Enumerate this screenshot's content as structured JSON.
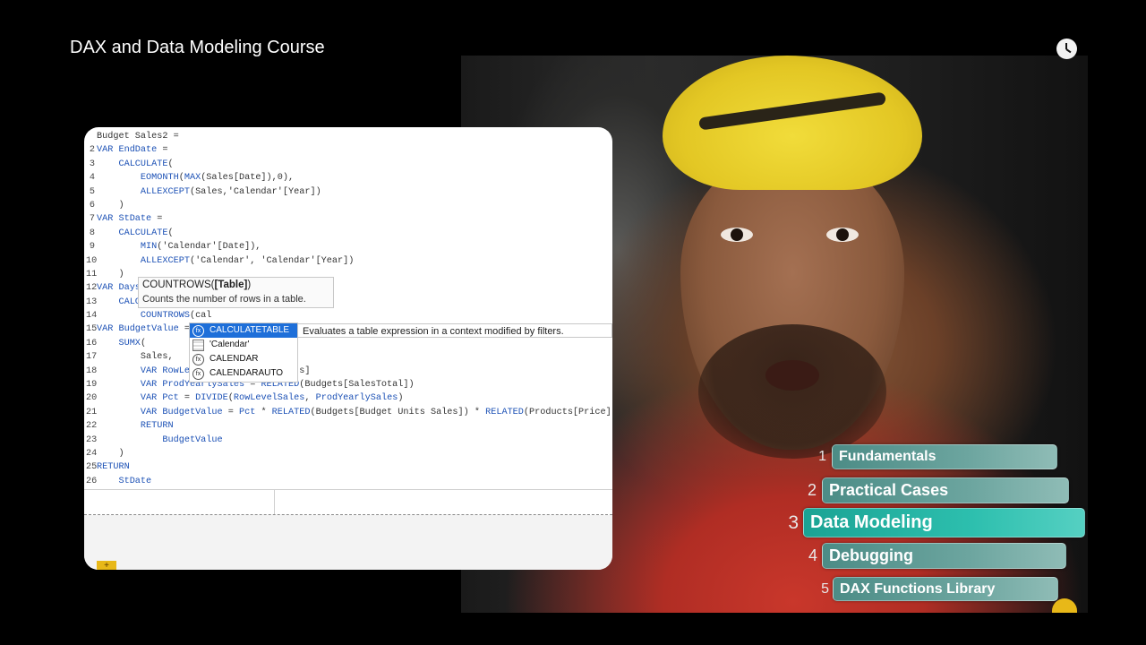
{
  "header": {
    "title": "DAX and Data Modeling Course",
    "clock_icon": "clock-icon"
  },
  "editor": {
    "lines": [
      {
        "n": "",
        "parts": [
          [
            "t",
            "Budget Sales2 ="
          ]
        ]
      },
      {
        "n": "2",
        "parts": [
          [
            "k",
            "VAR "
          ],
          [
            "k",
            "EndDate"
          ],
          [
            "t",
            " ="
          ]
        ]
      },
      {
        "n": "3",
        "parts": [
          [
            "t",
            "    "
          ],
          [
            "k",
            "CALCULATE"
          ],
          [
            "t",
            "("
          ]
        ]
      },
      {
        "n": "4",
        "parts": [
          [
            "t",
            "        "
          ],
          [
            "k",
            "EOMONTH"
          ],
          [
            "t",
            "("
          ],
          [
            "k",
            "MAX"
          ],
          [
            "t",
            "(Sales[Date]),"
          ],
          [
            "t",
            "0"
          ],
          [
            "t",
            "),"
          ]
        ]
      },
      {
        "n": "5",
        "parts": [
          [
            "t",
            "        "
          ],
          [
            "k",
            "ALLEXCEPT"
          ],
          [
            "t",
            "(Sales,'Calendar'[Year])"
          ]
        ]
      },
      {
        "n": "6",
        "parts": [
          [
            "t",
            "    )"
          ]
        ]
      },
      {
        "n": "7",
        "parts": [
          [
            "k",
            "VAR "
          ],
          [
            "k",
            "StDate"
          ],
          [
            "t",
            " ="
          ]
        ]
      },
      {
        "n": "8",
        "parts": [
          [
            "t",
            "    "
          ],
          [
            "k",
            "CALCULATE"
          ],
          [
            "t",
            "("
          ]
        ]
      },
      {
        "n": "9",
        "parts": [
          [
            "t",
            "        "
          ],
          [
            "k",
            "MIN"
          ],
          [
            "t",
            "('Calendar'[Date]),"
          ]
        ]
      },
      {
        "n": "10",
        "parts": [
          [
            "t",
            "        "
          ],
          [
            "k",
            "ALLEXCEPT"
          ],
          [
            "t",
            "('Calendar', 'Calendar'[Year])"
          ]
        ]
      },
      {
        "n": "11",
        "parts": [
          [
            "t",
            "    )"
          ]
        ]
      },
      {
        "n": "12",
        "parts": [
          [
            "k",
            "VAR "
          ],
          [
            "k",
            "Days"
          ]
        ]
      },
      {
        "n": "13",
        "parts": [
          [
            "t",
            "    "
          ],
          [
            "k",
            "CALC"
          ]
        ]
      },
      {
        "n": "14",
        "parts": [
          [
            "t",
            "        "
          ],
          [
            "k",
            "COUNTROWS"
          ],
          [
            "t",
            "(cal"
          ]
        ]
      },
      {
        "n": "15",
        "parts": [
          [
            "k",
            "VAR "
          ],
          [
            "k",
            "BudgetValue"
          ],
          [
            "t",
            " ="
          ]
        ]
      },
      {
        "n": "16",
        "parts": [
          [
            "t",
            "    "
          ],
          [
            "k",
            "SUMX"
          ],
          [
            "t",
            "("
          ]
        ]
      },
      {
        "n": "17",
        "parts": [
          [
            "t",
            "        Sales,"
          ]
        ]
      },
      {
        "n": "18",
        "parts": [
          [
            "t",
            "        "
          ],
          [
            "k",
            "VAR "
          ],
          [
            "k",
            "RowLevel"
          ],
          [
            "t",
            "                 s]"
          ]
        ]
      },
      {
        "n": "19",
        "parts": [
          [
            "t",
            "        "
          ],
          [
            "k",
            "VAR "
          ],
          [
            "k",
            "ProdYearlySales"
          ],
          [
            "t",
            " = "
          ],
          [
            "k",
            "RELATED"
          ],
          [
            "t",
            "(Budgets[SalesTotal])"
          ]
        ]
      },
      {
        "n": "20",
        "parts": [
          [
            "t",
            "        "
          ],
          [
            "k",
            "VAR "
          ],
          [
            "k",
            "Pct"
          ],
          [
            "t",
            " = "
          ],
          [
            "k",
            "DIVIDE"
          ],
          [
            "t",
            "("
          ],
          [
            "k",
            "RowLevelSales"
          ],
          [
            "t",
            ", "
          ],
          [
            "k",
            "ProdYearlySales"
          ],
          [
            "t",
            ")"
          ]
        ]
      },
      {
        "n": "21",
        "parts": [
          [
            "t",
            "        "
          ],
          [
            "k",
            "VAR "
          ],
          [
            "k",
            "BudgetValue"
          ],
          [
            "t",
            " = "
          ],
          [
            "k",
            "Pct"
          ],
          [
            "t",
            " * "
          ],
          [
            "k",
            "RELATED"
          ],
          [
            "t",
            "(Budgets[Budget Units Sales]) * "
          ],
          [
            "k",
            "RELATED"
          ],
          [
            "t",
            "(Products[Price])"
          ]
        ]
      },
      {
        "n": "22",
        "parts": [
          [
            "t",
            "        "
          ],
          [
            "k",
            "RETURN"
          ]
        ]
      },
      {
        "n": "23",
        "parts": [
          [
            "t",
            "            "
          ],
          [
            "k",
            "BudgetValue"
          ]
        ]
      },
      {
        "n": "24",
        "parts": [
          [
            "t",
            "    )"
          ]
        ]
      },
      {
        "n": "25",
        "parts": [
          [
            "k",
            "RETURN"
          ]
        ]
      },
      {
        "n": "26",
        "parts": [
          [
            "t",
            "    "
          ],
          [
            "k",
            "StDate"
          ]
        ]
      }
    ],
    "add_tab": "+"
  },
  "tooltip": {
    "sig_prefix": "COUNTROWS(",
    "sig_param": "[Table]",
    "sig_suffix": ")",
    "description": "Counts the number of rows in a table."
  },
  "autocomplete": {
    "items": [
      {
        "label": "CALCULATETABLE",
        "icon": "function-icon",
        "glyph": "fx",
        "selected": true
      },
      {
        "label": "'Calendar'",
        "icon": "table-icon",
        "glyph": "",
        "selected": false
      },
      {
        "label": "CALENDAR",
        "icon": "function-icon",
        "glyph": "fx",
        "selected": false
      },
      {
        "label": "CALENDARAUTO",
        "icon": "function-icon",
        "glyph": "fx",
        "selected": false
      }
    ],
    "description": "Evaluates a table expression in a context modified by filters."
  },
  "course_menu": [
    {
      "num": "1",
      "label": "Fundamentals",
      "active": false
    },
    {
      "num": "2",
      "label": "Practical Cases",
      "active": false
    },
    {
      "num": "3",
      "label": "Data Modeling",
      "active": true
    },
    {
      "num": "4",
      "label": "Debugging",
      "active": false
    },
    {
      "num": "5",
      "label": "DAX Functions Library",
      "active": false
    }
  ],
  "colors": {
    "keyword": "#1b50b5",
    "menu_bar": "#6ca59f",
    "menu_active": "#2dbfae",
    "autocomplete_selected": "#1e6fd9"
  }
}
